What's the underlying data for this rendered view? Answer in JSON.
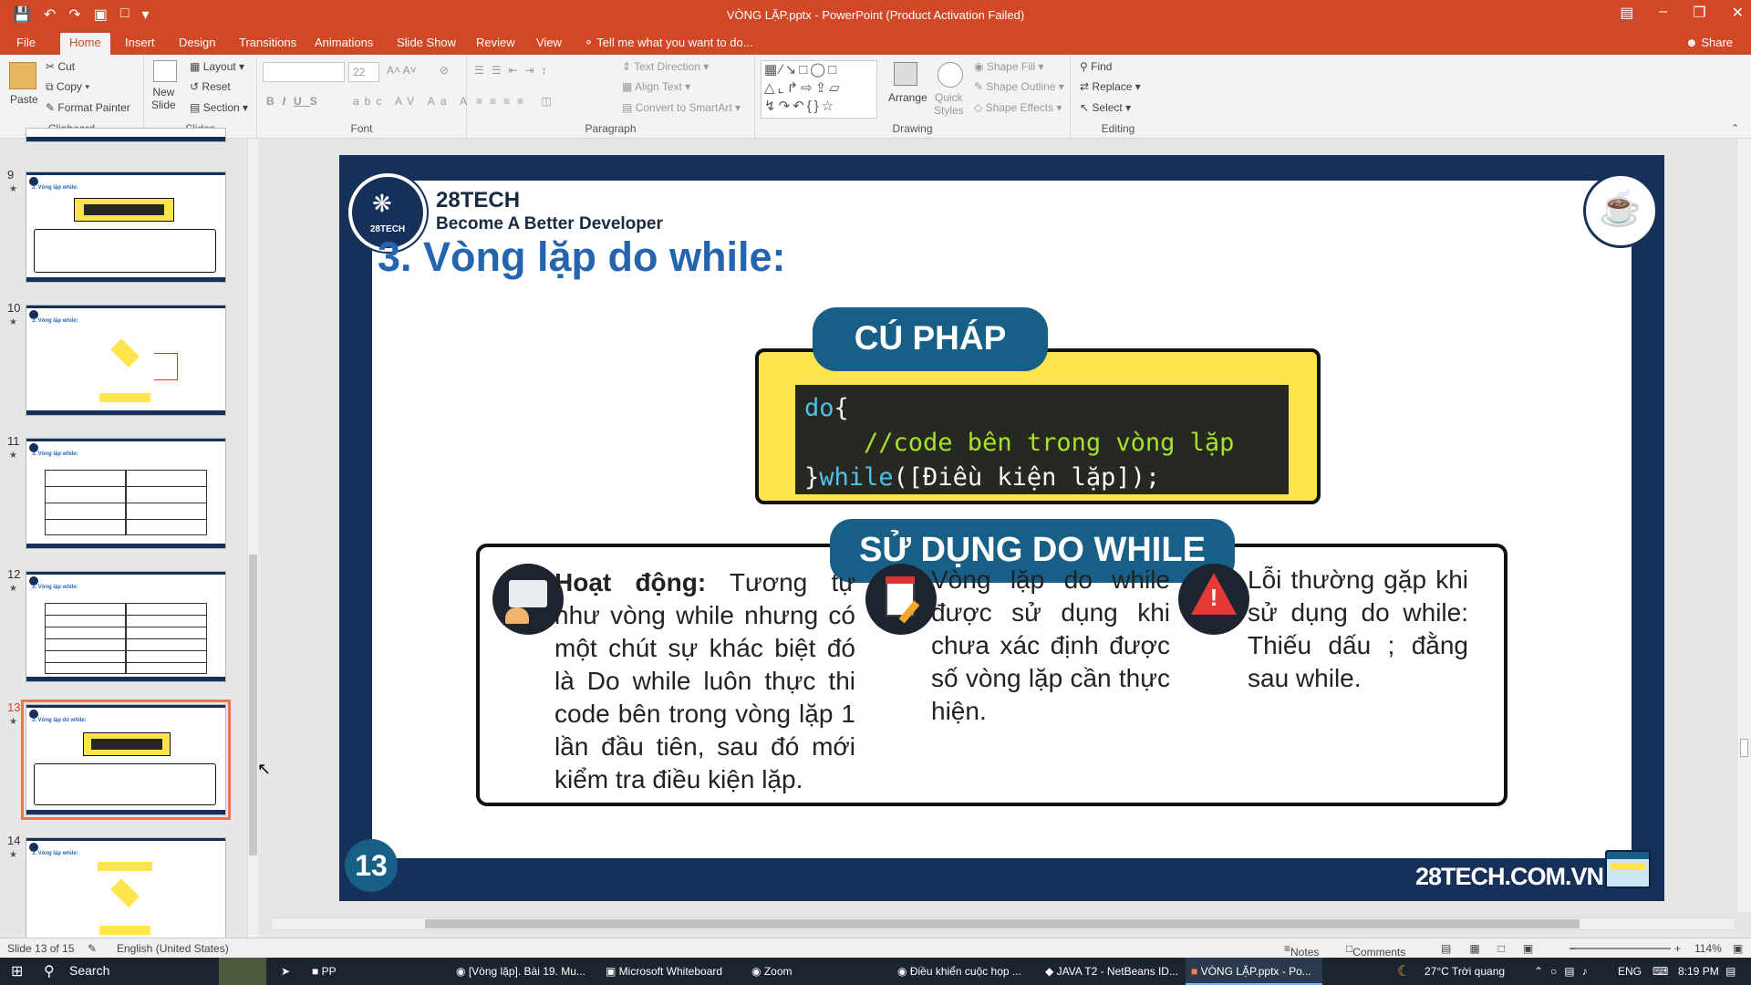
{
  "window": {
    "title": "VÒNG LẶP.pptx - PowerPoint (Product Activation Failed)"
  },
  "tabs": [
    {
      "label": "File"
    },
    {
      "label": "Home"
    },
    {
      "label": "Insert"
    },
    {
      "label": "Design"
    },
    {
      "label": "Transitions"
    },
    {
      "label": "Animations"
    },
    {
      "label": "Slide Show"
    },
    {
      "label": "Review"
    },
    {
      "label": "View"
    }
  ],
  "tell_me": "Tell me what you want to do...",
  "share": "Share",
  "ribbon": {
    "clipboard": {
      "paste": "Paste",
      "cut": "Cut",
      "copy": "Copy",
      "format_painter": "Format Painter",
      "label": "Clipboard"
    },
    "slides": {
      "new_slide_1": "New",
      "new_slide_2": "Slide",
      "layout": "Layout",
      "reset": "Reset",
      "section": "Section",
      "label": "Slides"
    },
    "font": {
      "size": "22",
      "label": "Font"
    },
    "paragraph": {
      "text_direction": "Text Direction",
      "align_text": "Align Text",
      "convert": "Convert to SmartArt",
      "label": "Paragraph"
    },
    "drawing": {
      "arrange": "Arrange",
      "quick_styles_1": "Quick",
      "quick_styles_2": "Styles",
      "shape_fill": "Shape Fill",
      "shape_outline": "Shape Outline",
      "shape_effects": "Shape Effects",
      "label": "Drawing"
    },
    "editing": {
      "find": "Find",
      "replace": "Replace",
      "select": "Select",
      "label": "Editing"
    }
  },
  "thumbnails": [
    {
      "num": "9",
      "title": "3. Vòng lặp while:"
    },
    {
      "num": "10",
      "title": "3. Vòng lặp while:"
    },
    {
      "num": "11",
      "title": "3. Vòng lặp while:"
    },
    {
      "num": "12",
      "title": "3. Vòng lặp while:"
    },
    {
      "num": "13",
      "title": "3. Vòng lặp do while:"
    },
    {
      "num": "14",
      "title": "3. Vòng lặp while:"
    }
  ],
  "slide": {
    "brand": "28TECH",
    "tagline": "Become A Better Developer",
    "logo_text": "28TECH",
    "title": "3. Vòng lặp do while:",
    "syntax_label": "CÚ PHÁP",
    "code": {
      "line1_kw": "do",
      "line1_rest": "{",
      "line2": "    //code bên trong vòng lặp",
      "line3_pre": "}",
      "line3_kw": "while",
      "line3_rest": "([Điều kiện lặp]);"
    },
    "use_label": "SỬ DỤNG DO WHILE",
    "col1_bold": "Hoạt động:",
    "col1_text": " Tương tự như vòng while nhưng có một chút sự khác biệt đó là Do while luôn thực thi code bên trong vòng lặp 1 lần đầu tiên, sau đó mới kiểm tra điều kiện lặp.",
    "col2_text": "Vòng lặp do while được sử dụng khi chưa xác định được số vòng lặp cần thực hiện.",
    "col3_text": "Lỗi thường gặp khi sử dụng do while: Thiếu dấu ; đằng sau while.",
    "page_num": "13",
    "website": "28TECH.COM.VN"
  },
  "status": {
    "slide_of": "Slide 13 of 15",
    "language": "English (United States)",
    "notes": "Notes",
    "comments": "Comments",
    "zoom": "114%"
  },
  "taskbar": {
    "search": "Search",
    "items": [
      "PP",
      "[Vòng lặp]. Bài 19. Mu...",
      "Microsoft Whiteboard",
      "Zoom",
      "Điều khiển cuộc họp ...",
      "JAVA T2 - NetBeans ID...",
      "VÒNG LẶP.pptx - Po..."
    ],
    "weather": "27°C  Trời quang",
    "lang": "ENG",
    "time": "8:19 PM"
  },
  "colors": {
    "accent": "#d24726",
    "slide_navy": "#16305a",
    "title_blue": "#2565b0",
    "label_teal": "#175f86",
    "yellow": "#ffe44d"
  }
}
